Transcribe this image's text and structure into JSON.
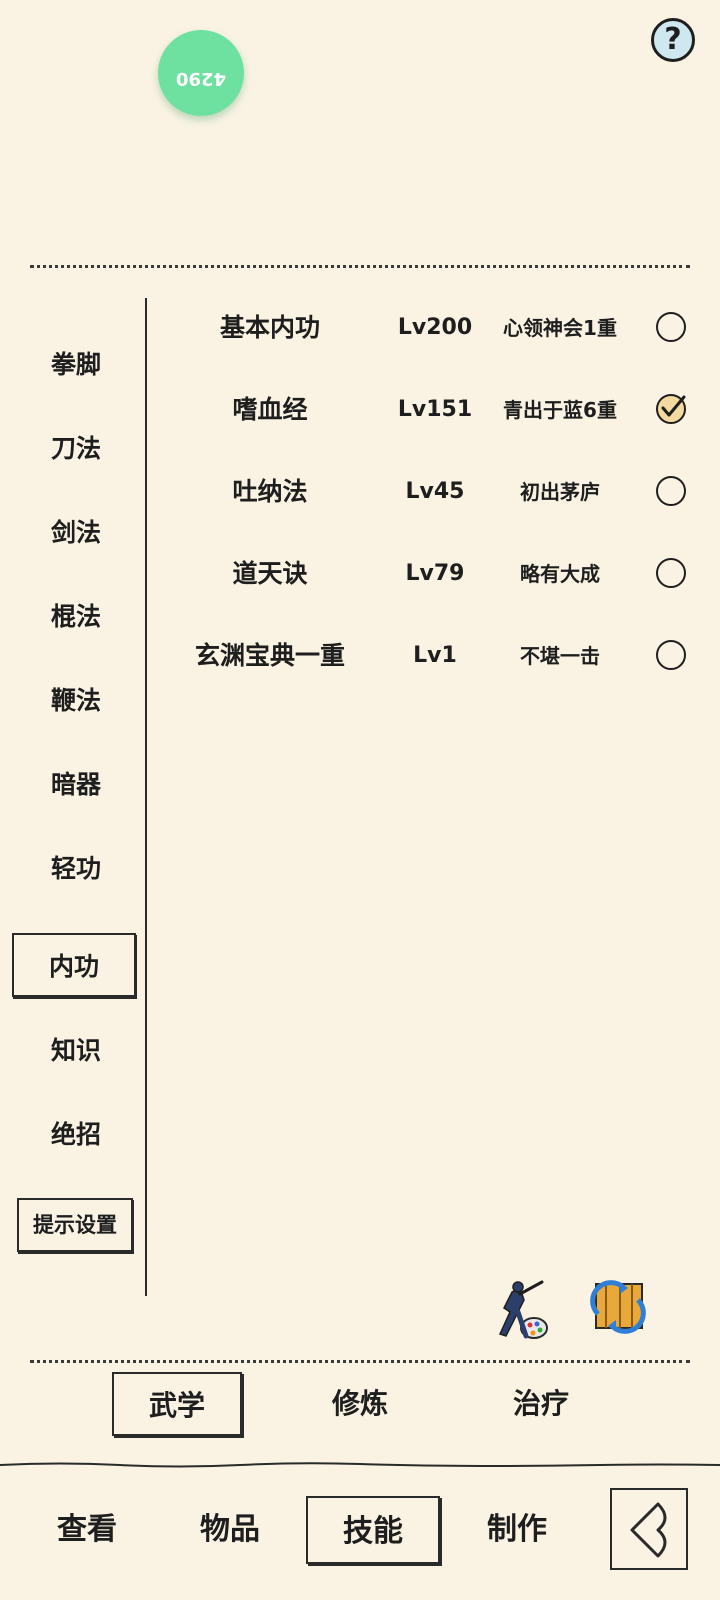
{
  "header": {
    "help_label": "?",
    "stamp_number": "4290"
  },
  "sidebar": {
    "items": [
      {
        "label": "拳脚"
      },
      {
        "label": "刀法"
      },
      {
        "label": "剑法"
      },
      {
        "label": "棍法"
      },
      {
        "label": "鞭法"
      },
      {
        "label": "暗器"
      },
      {
        "label": "轻功"
      },
      {
        "label": "内功",
        "active": true
      },
      {
        "label": "知识"
      },
      {
        "label": "绝招"
      }
    ],
    "hint_settings": "提示设置"
  },
  "skills": [
    {
      "name": "基本内功",
      "level": "Lv200",
      "rank": "心领神会1重",
      "selected": false
    },
    {
      "name": "嗜血经",
      "level": "Lv151",
      "rank": "青出于蓝6重",
      "selected": true
    },
    {
      "name": "吐纳法",
      "level": "Lv45",
      "rank": "初出茅庐",
      "selected": false
    },
    {
      "name": "道天诀",
      "level": "Lv79",
      "rank": "略有大成",
      "selected": false
    },
    {
      "name": "玄渊宝典一重",
      "level": "Lv1",
      "rank": "不堪一击",
      "selected": false
    }
  ],
  "action_icons": [
    "warrior-paint-icon",
    "swap-scroll-icon"
  ],
  "tabs": [
    {
      "label": "武学",
      "active": true
    },
    {
      "label": "修炼"
    },
    {
      "label": "治疗"
    }
  ],
  "bottom_nav": [
    {
      "label": "查看"
    },
    {
      "label": "物品"
    },
    {
      "label": "技能",
      "active": true
    },
    {
      "label": "制作"
    }
  ],
  "colors": {
    "background": "#faf3e3",
    "ink": "#1e1e1e",
    "check_fill": "#f4d9a0",
    "stamp_green": "#6ee0a0"
  }
}
